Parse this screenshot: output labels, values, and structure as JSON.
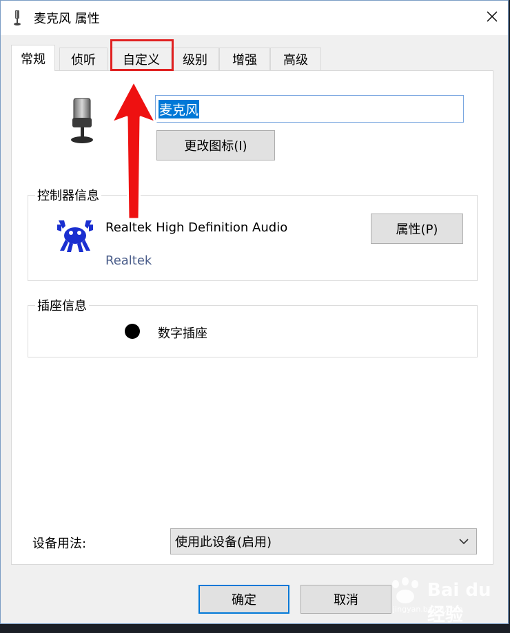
{
  "window": {
    "title": "麦克风 属性",
    "close_glyph": "✕"
  },
  "tabs": [
    {
      "label": "常规",
      "active": true
    },
    {
      "label": "侦听"
    },
    {
      "label": "自定义"
    },
    {
      "label": "级别"
    },
    {
      "label": "增强"
    },
    {
      "label": "高级"
    }
  ],
  "device": {
    "name_value": "麦克风",
    "change_icon_label": "更改图标(I)",
    "icon": "microphone-icon"
  },
  "controller": {
    "group_title": "控制器信息",
    "name": "Realtek High Definition Audio",
    "vendor": "Realtek",
    "properties_label": "属性(P)",
    "logo": "realtek-crab-logo"
  },
  "jack": {
    "group_title": "插座信息",
    "label": "数字插座"
  },
  "usage": {
    "label": "设备用法:",
    "selected": "使用此设备(启用)",
    "icon": "chevron-down-icon"
  },
  "buttons": {
    "ok": "确定",
    "cancel": "取消"
  },
  "annotation": {
    "highlight_color": "#e02020"
  },
  "watermark": {
    "text": "Bai du 经验",
    "sub": "jingyan.baidu.com"
  },
  "colors": {
    "selection": "#0078d7",
    "vendor_text": "#4a5d8a",
    "logo_blue": "#1a2fd0"
  }
}
